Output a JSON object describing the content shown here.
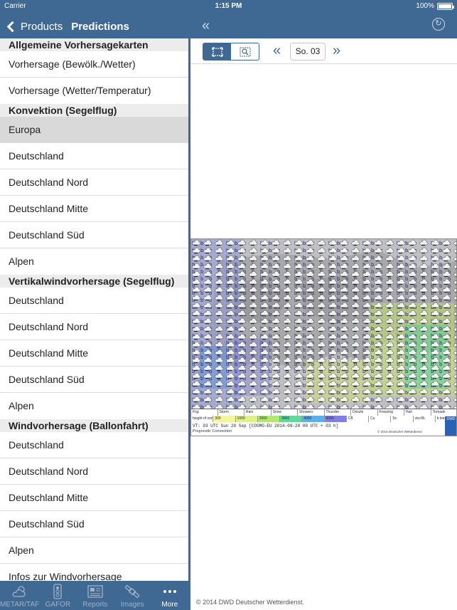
{
  "status": {
    "carrier": "Carrier",
    "time": "1:15 PM",
    "battery": "100%"
  },
  "nav": {
    "back_label": "Products",
    "title": "Predictions"
  },
  "sections": [
    {
      "header": "Allgemeine Vorhersagekarten",
      "items": [
        "Vorhersage (Bewölk./Wetter)",
        "Vorhersage (Wetter/Temperatur)"
      ]
    },
    {
      "header": "Konvektion (Segelflug)",
      "items": [
        "Europa",
        "Deutschland",
        "Deutschland Nord",
        "Deutschland Mitte",
        "Deutschland Süd",
        "Alpen"
      ]
    },
    {
      "header": "Vertikalwindvorhersage (Segelflug)",
      "items": [
        "Deutschland",
        "Deutschland Nord",
        "Deutschland Mitte",
        "Deutschland Süd",
        "Alpen"
      ]
    },
    {
      "header": "Windvorhersage (Ballonfahrt)",
      "items": [
        "Deutschland",
        "Deutschland Nord",
        "Deutschland Mitte",
        "Deutschland Süd",
        "Alpen",
        "Infos zur Windvorhersage"
      ]
    }
  ],
  "selected_item": "Europa",
  "tabs": [
    {
      "label": "METAR/TAF",
      "icon": "cloud-sun-icon"
    },
    {
      "label": "GAFOR",
      "icon": "traffic-light-icon"
    },
    {
      "label": "Reports",
      "icon": "newspaper-icon"
    },
    {
      "label": "Images",
      "icon": "satellite-icon"
    },
    {
      "label": "More",
      "icon": "more-dots-icon",
      "active": true
    }
  ],
  "toolbar": {
    "day": "So. 03"
  },
  "map_legend": {
    "row1": [
      "Fog",
      "Storm",
      "Rain",
      "Snow",
      "Showers",
      "Thunder",
      "Drizzle",
      "Freezing",
      "Hail",
      "Tornado"
    ],
    "row2": [
      "height of conv. cloud",
      "300",
      "1000",
      "2000",
      "3000",
      "4000",
      "5000",
      "CB",
      "Cu",
      "Sc",
      "vis<5k",
      "b lee"
    ],
    "valid_time": "VT: 03 UTC Sun 28 Sep [COSMO-EU 2014-09-28 00 UTC + 03 h]",
    "product": "Prognostic Convection",
    "copyright": "© 2014 Deutscher Wetterdienst",
    "logo": "DWD"
  },
  "footer": "© 2014 DWD Deutscher Wetterdienst.",
  "colors": {
    "bar": "#3f6893",
    "selected": "#d9d9d9",
    "section": "#ececec"
  }
}
